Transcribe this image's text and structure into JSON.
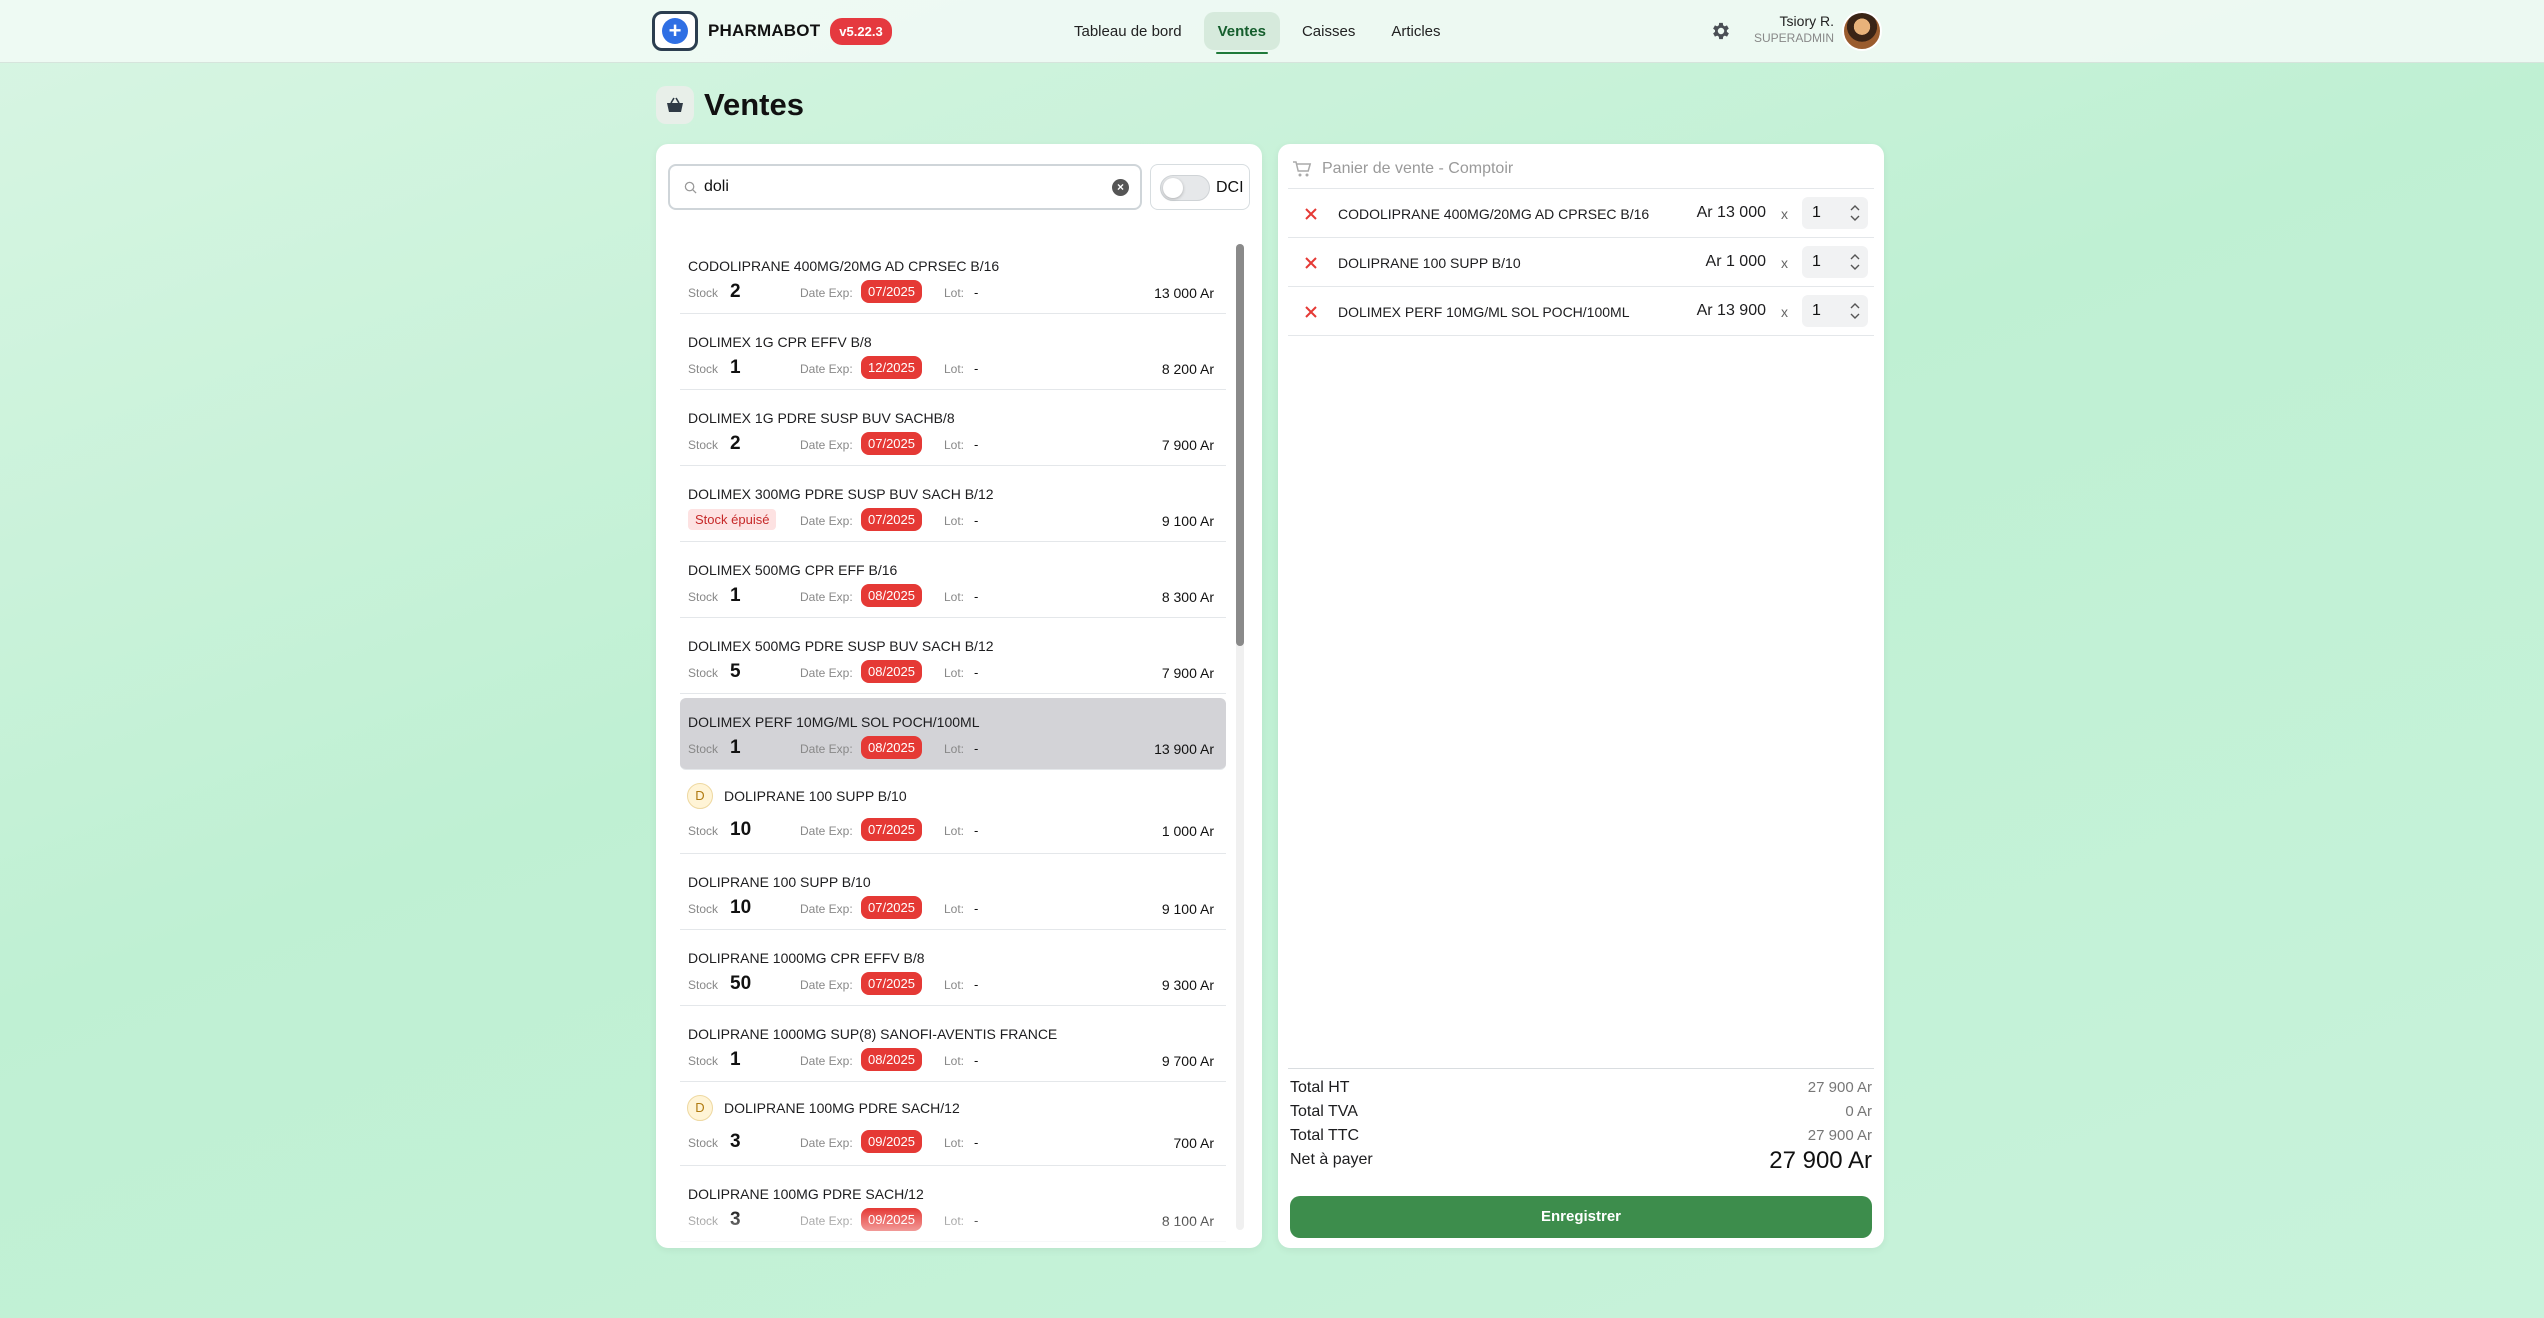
{
  "header": {
    "brand_name": "PHARMABOT",
    "version": "v5.22.3",
    "nav": [
      {
        "label": "Tableau de bord",
        "active": false
      },
      {
        "label": "Ventes",
        "active": true
      },
      {
        "label": "Caisses",
        "active": false
      },
      {
        "label": "Articles",
        "active": false
      }
    ],
    "settings_icon": "gear-icon",
    "user": {
      "name": "Tsiory R.",
      "role": "SUPERADMIN"
    }
  },
  "page": {
    "title": "Ventes",
    "icon": "basket-icon"
  },
  "search": {
    "value": "doli",
    "dci_label": "DCI",
    "dci_enabled": false
  },
  "labels": {
    "stock": "Stock",
    "date_exp": "Date Exp:",
    "lot": "Lot:"
  },
  "products": [
    {
      "name": "CODOLIPRANE 400MG/20MG AD CPRSEC B/16",
      "stock": "2",
      "exp": "07/2025",
      "lot": "-",
      "price": "13 000 Ar",
      "badge": "",
      "selected": false
    },
    {
      "name": "DOLIMEX 1G CPR EFFV B/8",
      "stock": "1",
      "exp": "12/2025",
      "lot": "-",
      "price": "8 200 Ar",
      "badge": "",
      "selected": false
    },
    {
      "name": "DOLIMEX 1G PDRE SUSP BUV SACHB/8",
      "stock": "2",
      "exp": "07/2025",
      "lot": "-",
      "price": "7 900 Ar",
      "badge": "",
      "selected": false
    },
    {
      "name": "DOLIMEX 300MG PDRE SUSP BUV SACH B/12",
      "stock": "",
      "stock_out": "Stock épuisé",
      "exp": "07/2025",
      "lot": "-",
      "price": "9 100 Ar",
      "badge": "",
      "selected": false
    },
    {
      "name": "DOLIMEX 500MG CPR EFF B/16",
      "stock": "1",
      "exp": "08/2025",
      "lot": "-",
      "price": "8 300 Ar",
      "badge": "",
      "selected": false
    },
    {
      "name": "DOLIMEX 500MG PDRE SUSP BUV SACH B/12",
      "stock": "5",
      "exp": "08/2025",
      "lot": "-",
      "price": "7 900 Ar",
      "badge": "",
      "selected": false
    },
    {
      "name": "DOLIMEX PERF 10MG/ML SOL POCH/100ML",
      "stock": "1",
      "exp": "08/2025",
      "lot": "-",
      "price": "13 900 Ar",
      "badge": "",
      "selected": true
    },
    {
      "name": "DOLIPRANE 100 SUPP B/10",
      "stock": "10",
      "exp": "07/2025",
      "lot": "-",
      "price": "1 000 Ar",
      "badge": "D",
      "selected": false
    },
    {
      "name": "DOLIPRANE 100 SUPP B/10",
      "stock": "10",
      "exp": "07/2025",
      "lot": "-",
      "price": "9 100 Ar",
      "badge": "",
      "selected": false
    },
    {
      "name": "DOLIPRANE 1000MG CPR EFFV B/8",
      "stock": "50",
      "exp": "07/2025",
      "lot": "-",
      "price": "9 300 Ar",
      "badge": "",
      "selected": false
    },
    {
      "name": "DOLIPRANE 1000MG SUP(8) SANOFI-AVENTIS FRANCE",
      "stock": "1",
      "exp": "08/2025",
      "lot": "-",
      "price": "9 700 Ar",
      "badge": "",
      "selected": false
    },
    {
      "name": "DOLIPRANE 100MG PDRE SACH/12",
      "stock": "3",
      "exp": "09/2025",
      "lot": "-",
      "price": "700 Ar",
      "badge": "D",
      "selected": false
    },
    {
      "name": "DOLIPRANE 100MG PDRE SACH/12",
      "stock": "3",
      "exp": "09/2025",
      "lot": "-",
      "price": "8 100 Ar",
      "badge": "",
      "selected": false
    }
  ],
  "list_scroll_fraction": 0.41,
  "cart": {
    "title": "Panier de vente - Comptoir",
    "items": [
      {
        "name": "CODOLIPRANE 400MG/20MG AD CPRSEC B/16",
        "price": "Ar 13 000",
        "x": "x",
        "qty": "1"
      },
      {
        "name": "DOLIPRANE 100 SUPP B/10",
        "price": "Ar 1 000",
        "x": "x",
        "qty": "1"
      },
      {
        "name": "DOLIMEX PERF 10MG/ML SOL POCH/100ML",
        "price": "Ar 13 900",
        "x": "x",
        "qty": "1"
      }
    ],
    "totals": {
      "ht_label": "Total HT",
      "ht": "27 900 Ar",
      "tva_label": "Total TVA",
      "tva": "0 Ar",
      "ttc_label": "Total TTC",
      "ttc": "27 900 Ar",
      "net_label": "Net à payer",
      "net": "27 900 Ar"
    },
    "save_label": "Enregistrer"
  },
  "colors": {
    "accent_green": "#3d8d4c",
    "danger_red": "#e53935",
    "version_red": "#e5393f"
  }
}
